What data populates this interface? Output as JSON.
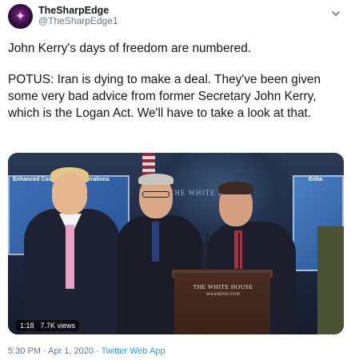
{
  "author": {
    "display_name": "TheSharpEdge",
    "handle": "@TheSharpEdge1",
    "avatar_glyph": "✦"
  },
  "tweet": {
    "paragraph1": "John Kerry's days of freedom are numbered.",
    "paragraph2": "POTUS: Iran is dying to make a deal.  They've been given some very bad advice from former Secretary John Kerry, which is the Logan Act.  We'll have to take a look at that."
  },
  "video": {
    "duration": "1:18",
    "views": "7.7K views",
    "screen_left_label": "Enhanced Cou",
    "screen_left_label2": "Operations",
    "screen_right_label": "Enha",
    "wall_text": "THE WHITE HOUSE",
    "podium_line1": "THE WHITE HOUSE",
    "podium_line2": "WASHINGTON"
  },
  "footer": {
    "time": "5:30 PM",
    "separator": "·",
    "date": "Apr 1, 2020",
    "source": "Twitter Web App"
  },
  "colors": {
    "link": "#1da1f2",
    "muted": "#657786",
    "text": "#14171a"
  },
  "icons": {
    "menu": "chevron-down-icon"
  }
}
